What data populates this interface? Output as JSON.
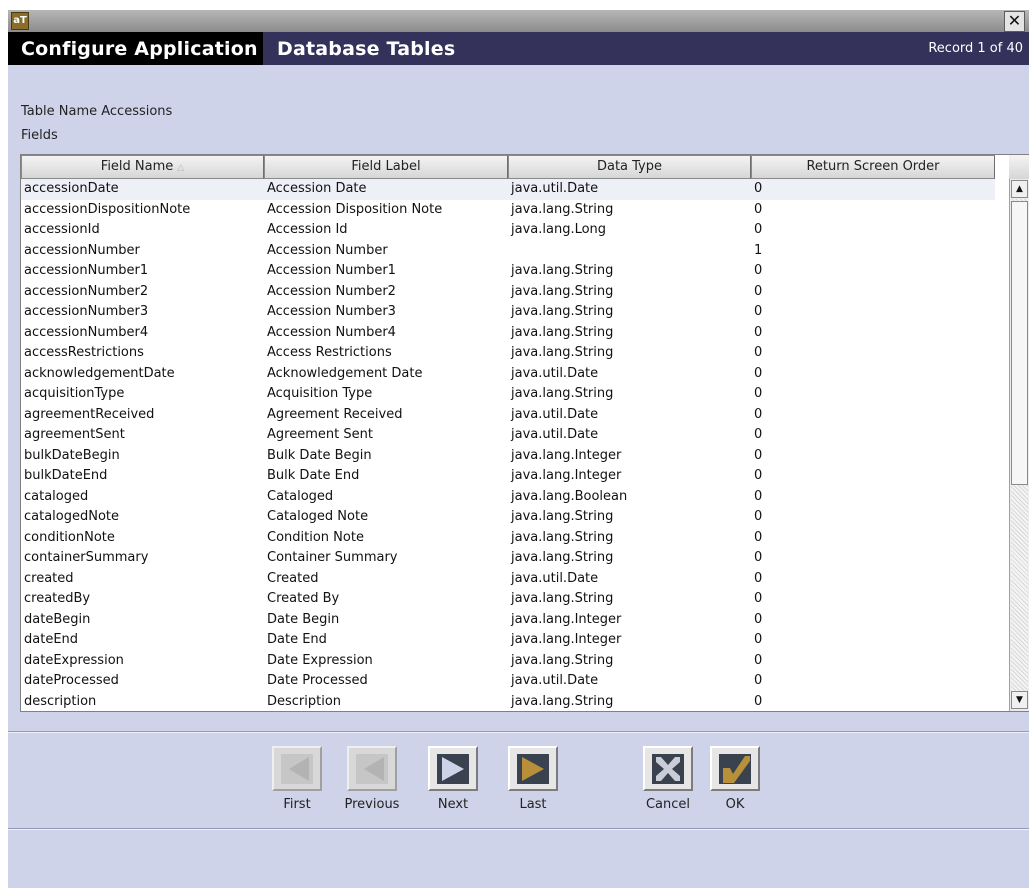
{
  "window": {
    "app_logo": "aT",
    "close_glyph": "✕"
  },
  "header": {
    "title": "Configure Application",
    "section": "Database Tables",
    "record_counter": "Record 1 of 40"
  },
  "form": {
    "table_name_label": "Table Name Accessions",
    "fields_label": "Fields"
  },
  "table": {
    "columns": [
      "Field Name",
      "Field Label",
      "Data Type",
      "Return Screen Order"
    ],
    "sort_indicator": "△",
    "rows": [
      [
        "accessionDate",
        "Accession Date",
        "java.util.Date",
        "0"
      ],
      [
        "accessionDispositionNote",
        "Accession Disposition Note",
        "java.lang.String",
        "0"
      ],
      [
        "accessionId",
        "Accession Id",
        "java.lang.Long",
        "0"
      ],
      [
        "accessionNumber",
        "Accession Number",
        "",
        "1"
      ],
      [
        "accessionNumber1",
        "Accession Number1",
        "java.lang.String",
        "0"
      ],
      [
        "accessionNumber2",
        "Accession Number2",
        "java.lang.String",
        "0"
      ],
      [
        "accessionNumber3",
        "Accession Number3",
        "java.lang.String",
        "0"
      ],
      [
        "accessionNumber4",
        "Accession Number4",
        "java.lang.String",
        "0"
      ],
      [
        "accessRestrictions",
        "Access Restrictions",
        "java.lang.String",
        "0"
      ],
      [
        "acknowledgementDate",
        "Acknowledgement Date",
        "java.util.Date",
        "0"
      ],
      [
        "acquisitionType",
        "Acquisition Type",
        "java.lang.String",
        "0"
      ],
      [
        "agreementReceived",
        "Agreement Received",
        "java.util.Date",
        "0"
      ],
      [
        "agreementSent",
        "Agreement Sent",
        "java.util.Date",
        "0"
      ],
      [
        "bulkDateBegin",
        "Bulk Date Begin",
        "java.lang.Integer",
        "0"
      ],
      [
        "bulkDateEnd",
        "Bulk Date End",
        "java.lang.Integer",
        "0"
      ],
      [
        "cataloged",
        "Cataloged",
        "java.lang.Boolean",
        "0"
      ],
      [
        "catalogedNote",
        "Cataloged Note",
        "java.lang.String",
        "0"
      ],
      [
        "conditionNote",
        "Condition Note",
        "java.lang.String",
        "0"
      ],
      [
        "containerSummary",
        "Container Summary",
        "java.lang.String",
        "0"
      ],
      [
        "created",
        "Created",
        "java.util.Date",
        "0"
      ],
      [
        "createdBy",
        "Created By",
        "java.lang.String",
        "0"
      ],
      [
        "dateBegin",
        "Date Begin",
        "java.lang.Integer",
        "0"
      ],
      [
        "dateEnd",
        "Date End",
        "java.lang.Integer",
        "0"
      ],
      [
        "dateExpression",
        "Date Expression",
        "java.lang.String",
        "0"
      ],
      [
        "dateProcessed",
        "Date Processed",
        "java.util.Date",
        "0"
      ],
      [
        "description",
        "Description",
        "java.lang.String",
        "0"
      ]
    ]
  },
  "buttons": {
    "first": "First",
    "previous": "Previous",
    "next": "Next",
    "last": "Last",
    "cancel": "Cancel",
    "ok": "OK"
  },
  "scrollbar": {
    "up_glyph": "▲",
    "down_glyph": "▼"
  },
  "colors": {
    "header_bg": "#34315a",
    "window_bg": "#cfd3e9",
    "icon_dark": "#39424e",
    "icon_gold": "#b8903a"
  }
}
